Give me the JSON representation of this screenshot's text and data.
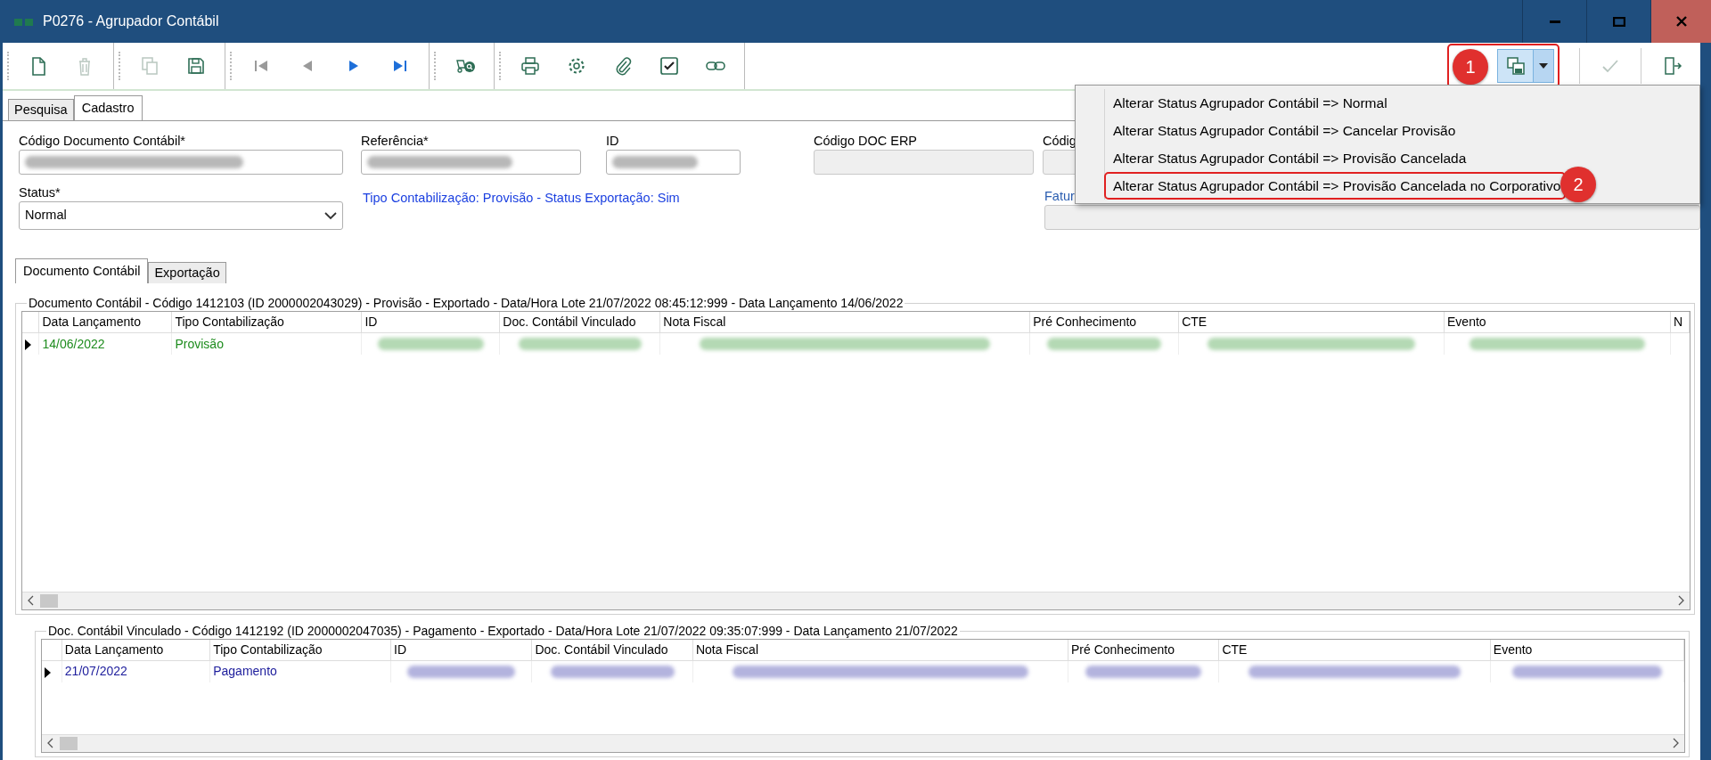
{
  "window": {
    "title": "P0276 - Agrupador Contábil"
  },
  "toolbar": {
    "groups": [
      [
        {
          "kind": "new",
          "disabled": false
        },
        {
          "kind": "delete",
          "disabled": true
        }
      ],
      [
        {
          "kind": "copy",
          "disabled": true
        },
        {
          "kind": "save",
          "disabled": false
        }
      ],
      [
        {
          "kind": "first",
          "disabled": true
        },
        {
          "kind": "prev",
          "disabled": true
        },
        {
          "kind": "next",
          "disabled": false
        },
        {
          "kind": "last",
          "disabled": false
        }
      ],
      [
        {
          "kind": "vehicle-search",
          "disabled": false
        }
      ],
      [
        {
          "kind": "print",
          "disabled": false
        },
        {
          "kind": "settings",
          "disabled": false
        },
        {
          "kind": "attach",
          "disabled": false
        },
        {
          "kind": "checkbox",
          "disabled": false
        },
        {
          "kind": "link",
          "disabled": false
        }
      ]
    ],
    "split_button": {
      "expanded": true,
      "outlined": true,
      "badge": "1"
    },
    "right": [
      {
        "kind": "confirm",
        "disabled": true
      },
      {
        "kind": "exit",
        "disabled": false
      }
    ]
  },
  "menu": {
    "items": [
      {
        "label": "Alterar Status Agrupador Contábil => Normal",
        "outlined": false
      },
      {
        "label": "Alterar Status Agrupador Contábil => Cancelar Provisão",
        "outlined": false
      },
      {
        "label": "Alterar Status Agrupador Contábil => Provisão Cancelada",
        "outlined": false
      },
      {
        "label": "Alterar Status Agrupador Contábil => Provisão Cancelada no Corporativo",
        "outlined": true,
        "badge": "2"
      }
    ]
  },
  "tabs": [
    {
      "label": "Pesquisa",
      "selected": false
    },
    {
      "label": "Cadastro",
      "selected": true
    }
  ],
  "form": {
    "row1": [
      {
        "label": "Código Documento Contábil*",
        "kind": "text",
        "redacted": true,
        "label_link": false
      },
      {
        "label": "Referência*",
        "kind": "text",
        "redacted": true,
        "label_link": false
      },
      {
        "label": "ID",
        "kind": "text",
        "redacted": true,
        "label_link": false
      },
      {
        "label": "Código DOC ERP",
        "kind": "disabled",
        "redacted": false,
        "label_link": false
      },
      {
        "label": "Códig",
        "kind": "disabled",
        "redacted": false,
        "label_link": false
      }
    ],
    "row2": [
      {
        "label": "Status*",
        "kind": "select",
        "value": "Normal",
        "label_link": false
      },
      {
        "kind": "info",
        "text": "Tipo Contabilização: Provisão - Status Exportação: Sim"
      },
      {
        "label": "Fatur",
        "kind": "disabled",
        "redacted": false,
        "label_link": true
      }
    ]
  },
  "subtabs": [
    {
      "label": "Documento Contábil",
      "selected": true
    },
    {
      "label": "Exportação",
      "selected": false
    }
  ],
  "grids": [
    {
      "title": "Documento Contábil - Código 1412103 (ID 2000002043029) - Provisão - Exportado - Data/Hora Lote 21/07/2022 08:45:12:999 - Data Lançamento 14/06/2022",
      "columns": [
        "Data Lançamento",
        "Tipo Contabilização",
        "ID",
        "Doc. Contábil Vinculado",
        "Nota Fiscal",
        "Pré Conhecimento",
        "CTE",
        "Evento",
        "N"
      ],
      "rows": [
        {
          "current": true,
          "color": "#1e8c1e",
          "cells": [
            {
              "text": "14/06/2022"
            },
            {
              "text": "Provisão"
            },
            {
              "redacted": true
            },
            {
              "redacted": true
            },
            {
              "redacted": true
            },
            {
              "redacted": true
            },
            {
              "redacted": true
            },
            {
              "redacted": true
            }
          ]
        }
      ]
    },
    {
      "title": "Doc. Contábil Vinculado - Código 1412192 (ID 2000002047035) - Pagamento - Exportado - Data/Hora Lote 21/07/2022 09:35:07:999 - Data Lançamento 21/07/2022",
      "columns": [
        "Data Lançamento",
        "Tipo Contabilização",
        "ID",
        "Doc. Contábil Vinculado",
        "Nota Fiscal",
        "Pré Conhecimento",
        "CTE",
        "Evento"
      ],
      "rows": [
        {
          "current": true,
          "color": "#1c1c9c",
          "cells": [
            {
              "text": "21/07/2022"
            },
            {
              "text": "Pagamento"
            },
            {
              "redacted": true
            },
            {
              "redacted": true
            },
            {
              "redacted": true
            },
            {
              "redacted": true
            },
            {
              "redacted": true
            },
            {
              "redacted": true
            }
          ]
        }
      ]
    }
  ]
}
